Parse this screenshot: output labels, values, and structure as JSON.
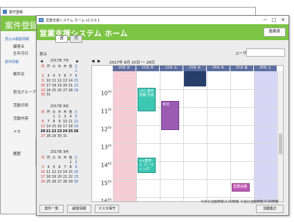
{
  "back": {
    "titlebar": "案件登録",
    "header": "案件登録",
    "link1": "見込み顧客情報",
    "label_customer": "顧客名",
    "label_birth": "生年月日",
    "link2": "案件情報",
    "label_case": "案件名",
    "label_group": "担当グループ",
    "label_date": "活動日時",
    "label_content": "活動内容",
    "label_memo": "メモ",
    "label_history": "履歴"
  },
  "front": {
    "titlebar": "営業支援システム ホーム v1.0.0.1",
    "title": "営業支援システム ホーム",
    "activity_btn": "勤務表",
    "view_label": "表示",
    "view_tabs": [
      "週",
      "月"
    ],
    "user_label": "ユーザ",
    "date_range": "2017年 8月 20日 ～ 26日",
    "minicals": [
      {
        "title": "2017年 7月",
        "days": [
          "",
          "",
          "",
          "",
          "",
          "",
          "1",
          "2",
          "3",
          "4",
          "5",
          "6",
          "7",
          "8",
          "9",
          "10",
          "11",
          "12",
          "13",
          "14",
          "15",
          "16",
          "17",
          "18",
          "19",
          "20",
          "21",
          "22",
          "23",
          "24",
          "25",
          "26",
          "27",
          "28",
          "29",
          "30",
          "31",
          "",
          "",
          "",
          "",
          ""
        ]
      },
      {
        "title": "2017年 8月",
        "days": [
          "",
          "",
          "1",
          "2",
          "3",
          "4",
          "5",
          "6",
          "7",
          "8",
          "9",
          "10",
          "11",
          "12",
          "13",
          "14",
          "15",
          "16",
          "17",
          "18",
          "19",
          "20",
          "21",
          "22",
          "23",
          "24",
          "25",
          "26",
          "27",
          "28",
          "29",
          "30",
          "31",
          "",
          ""
        ]
      },
      {
        "title": "2017年 9月",
        "days": [
          "",
          "",
          "",
          "",
          "",
          "1",
          "2",
          "3",
          "4",
          "5",
          "6",
          "7",
          "8",
          "9",
          "10",
          "11",
          "12",
          "13",
          "14",
          "15",
          "16",
          "17",
          "18",
          "19",
          "20",
          "21",
          "22",
          "23",
          "24",
          "25",
          "26",
          "27",
          "28",
          "29",
          "30"
        ]
      }
    ],
    "weekday_labels": [
      "日",
      "月",
      "火",
      "水",
      "木",
      "金",
      "土"
    ],
    "day_headers": [
      "20日 日",
      "21日 月",
      "22日 火",
      "23日 水",
      "24日 木",
      "25日 金",
      "26日 土"
    ],
    "hours": [
      "10",
      "11",
      "12",
      "13",
      "14",
      "15",
      "16",
      "17"
    ],
    "hour_suffix": "00",
    "events": {
      "e1": "〇〇 案件 見積 作成",
      "e2": "会合",
      "e3": "××案件と ミーティング",
      "e4": "営業会議"
    },
    "status_text": "今月の活動時間:0.00時間 今週の活動時間:0.00時間",
    "buttons": [
      "案件一覧",
      "顧客情報",
      "マスタ保守",
      "活動集計"
    ],
    "colors": {
      "accent": "#7cc443",
      "sunday": "#f7cdd5",
      "saturday": "#d7d6f5"
    }
  }
}
